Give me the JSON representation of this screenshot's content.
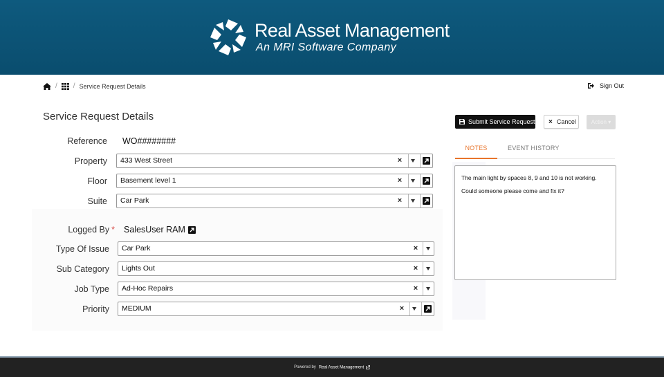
{
  "brand": {
    "title": "Real Asset Management",
    "subtitle": "An MRI Software Company"
  },
  "breadcrumb": {
    "home_icon": "home-icon",
    "apps_icon": "grid-icon",
    "current": "Service Request Details"
  },
  "header": {
    "sign_out_label": "Sign Out",
    "sign_out_icon": "sign-out-icon"
  },
  "page": {
    "title": "Service Request Details"
  },
  "form": {
    "reference": {
      "label": "Reference",
      "value": "WO########"
    },
    "property": {
      "label": "Property",
      "value": "433 West Street"
    },
    "floor": {
      "label": "Floor",
      "value": "Basement level 1"
    },
    "suite": {
      "label": "Suite",
      "value": "Car Park"
    },
    "logged_by": {
      "label": "Logged By",
      "required_mark": "*",
      "value": "SalesUser RAM"
    },
    "type_of_issue": {
      "label": "Type Of Issue",
      "value": "Car Park"
    },
    "sub_category": {
      "label": "Sub Category",
      "value": "Lights Out"
    },
    "job_type": {
      "label": "Job Type",
      "value": "Ad-Hoc Repairs"
    },
    "priority": {
      "label": "Priority",
      "value": "MEDIUM"
    },
    "clear_glyph": "×"
  },
  "actions": {
    "submit_label": "Submit Service Request",
    "cancel_label": "Cancel",
    "cancel_glyph": "×",
    "action_label": "Action ▾"
  },
  "tabs": [
    {
      "label": "NOTES",
      "active": true
    },
    {
      "label": "EVENT HISTORY",
      "active": false
    }
  ],
  "notes": {
    "line1": "The main light by spaces 8, 9 and 10 is not working.",
    "line2": "Could someone please come and fix it?"
  },
  "footer": {
    "powered_by": "Powered by",
    "link_text": "Real Asset Management"
  },
  "colors": {
    "banner": "#0a4d6e",
    "accent_tab": "#e8742b",
    "footer": "#222222"
  }
}
